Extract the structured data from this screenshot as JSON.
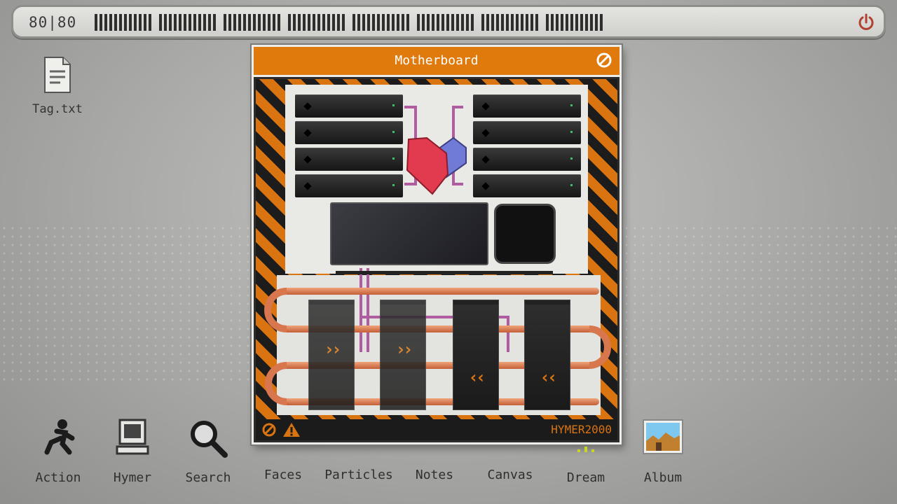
{
  "hud": {
    "health_text": "80|80",
    "health_value": 80,
    "health_max": 80,
    "power_icon": "power-icon"
  },
  "desktop": {
    "files": [
      {
        "label": "Tag.txt",
        "icon": "text-file-icon"
      }
    ]
  },
  "window": {
    "title": "Motherboard",
    "close_icon": "no-entry-icon",
    "brand": "HYMER2000",
    "warning_icons": [
      "no-entry-icon",
      "warning-icon"
    ],
    "fans": [
      {
        "arrow": "››"
      },
      {
        "arrow": "››"
      },
      {
        "arrow": "‹‹"
      },
      {
        "arrow": "‹‹"
      }
    ],
    "colors": {
      "accent": "#e07a0c",
      "hazard_dark": "#1c1c1c",
      "pipe": "#e48b62",
      "heart_red": "#e23a4e",
      "heart_blue": "#6f7bd6"
    }
  },
  "dock": {
    "items": [
      {
        "label": "Action",
        "icon": "running-figure-icon"
      },
      {
        "label": "Hymer",
        "icon": "computer-icon"
      },
      {
        "label": "Search",
        "icon": "magnifier-icon"
      },
      {
        "label": "Faces",
        "icon": "faces-icon"
      },
      {
        "label": "Particles",
        "icon": "particles-icon"
      },
      {
        "label": "Notes",
        "icon": "notes-icon"
      },
      {
        "label": "Canvas",
        "icon": "canvas-icon"
      },
      {
        "label": "Dream",
        "icon": "dream-icon"
      },
      {
        "label": "Album",
        "icon": "album-icon"
      }
    ]
  }
}
